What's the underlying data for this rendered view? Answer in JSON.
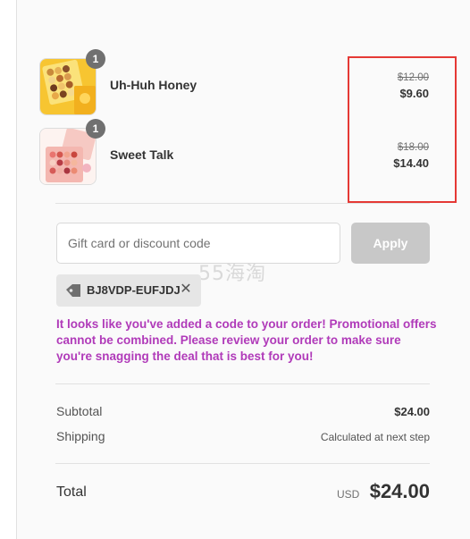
{
  "items": [
    {
      "name": "Uh-Huh Honey",
      "quantity": "1",
      "original_price": "$12.00",
      "price": "$9.60",
      "image": "yellow-eyeshadow-palette"
    },
    {
      "name": "Sweet Talk",
      "quantity": "1",
      "original_price": "$18.00",
      "price": "$14.40",
      "image": "pink-eyeshadow-palette"
    }
  ],
  "discount": {
    "placeholder": "Gift card or discount code",
    "apply_label": "Apply",
    "applied_code": "BJ8VDP-EUFJDJ",
    "tag_icon": "tag-icon",
    "remove_icon": "close-icon",
    "message": "It looks like you've added a code to your order! Promotional offers cannot be combined. Please review your order to make sure you're snagging the deal that is best for you!"
  },
  "watermark": "55海淘",
  "summary": {
    "subtotal_label": "Subtotal",
    "subtotal_value": "$24.00",
    "shipping_label": "Shipping",
    "shipping_value": "Calculated at next step",
    "total_label": "Total",
    "currency": "USD",
    "total_value": "$24.00"
  },
  "colors": {
    "highlight": "#e53935",
    "message": "#b03ab9",
    "apply_disabled": "#c8c8c8",
    "badge": "#707070"
  }
}
